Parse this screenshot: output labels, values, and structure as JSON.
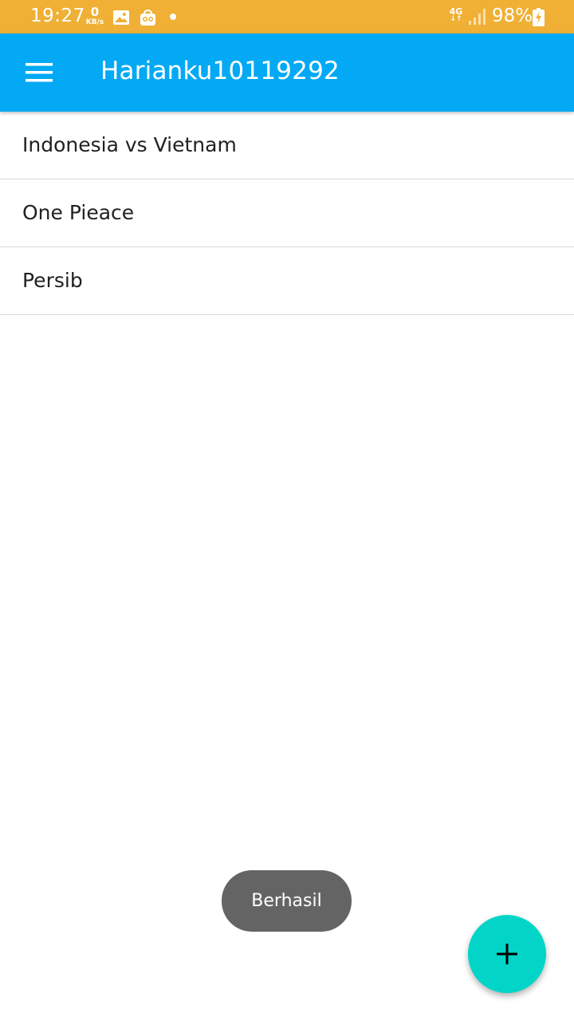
{
  "status_bar": {
    "time": "19:27",
    "network_speed_value": "0",
    "network_speed_unit": "KB/s",
    "network_type": "4G",
    "network_arrows": "↓↑",
    "battery_percent": "98%",
    "background_color": "#efb035",
    "icons": [
      "gallery-icon",
      "shopping-bag-icon",
      "notification-dot-icon",
      "signal-icon",
      "battery-charging-icon"
    ]
  },
  "app_bar": {
    "title": "Harianku10119292",
    "menu_icon": "hamburger-menu-icon",
    "background_color": "#03a9f4"
  },
  "list": {
    "items": [
      {
        "label": "Indonesia vs Vietnam"
      },
      {
        "label": "One Pieace"
      },
      {
        "label": "Persib"
      }
    ]
  },
  "toast": {
    "message": "Berhasil"
  },
  "fab": {
    "icon": "plus-icon",
    "background_color": "#02d5c8"
  }
}
